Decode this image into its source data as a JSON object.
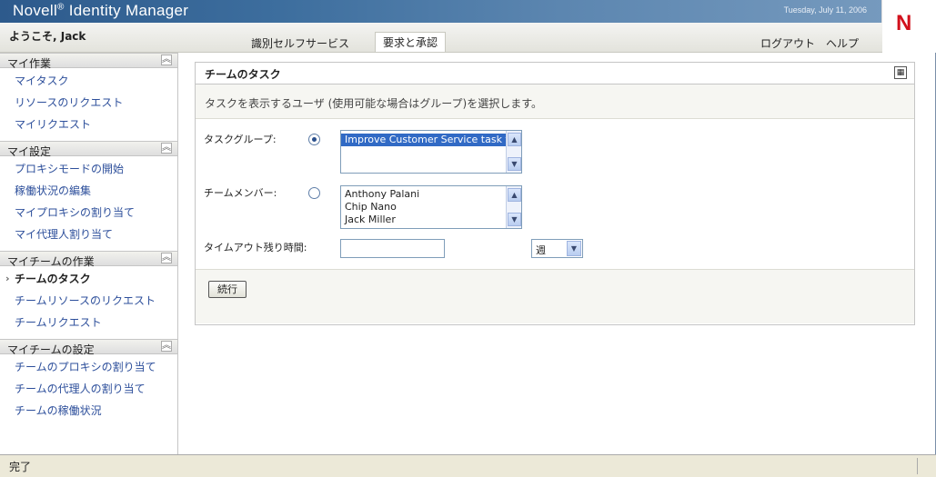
{
  "app": {
    "brand": "Novell",
    "product": "Identity Manager",
    "date": "Tuesday, July 11, 2006",
    "logo_letter": "N",
    "welcome": "ようこそ, Jack"
  },
  "nav": {
    "tabs": [
      {
        "label": "識別セルフサービス"
      },
      {
        "label": "要求と承認"
      }
    ],
    "right": [
      {
        "label": "ログアウト"
      },
      {
        "label": "ヘルプ"
      }
    ]
  },
  "sidebar": {
    "sections": [
      {
        "title": "マイ作業",
        "items": [
          "マイタスク",
          "リソースのリクエスト",
          "マイリクエスト"
        ]
      },
      {
        "title": "マイ設定",
        "items": [
          "プロキシモードの開始",
          "稼働状況の編集",
          "マイプロキシの割り当て",
          "マイ代理人割り当て"
        ]
      },
      {
        "title": "マイチームの作業",
        "items": [
          "チームのタスク",
          "チームリソースのリクエスト",
          "チームリクエスト"
        ]
      },
      {
        "title": "マイチームの設定",
        "items": [
          "チームのプロキシの割り当て",
          "チームの代理人の割り当て",
          "チームの稼働状況"
        ]
      }
    ],
    "current": "チームのタスク"
  },
  "panel": {
    "title": "チームのタスク",
    "instruction": "タスクを表示するユーザ (使用可能な場合はグループ)を選択します。",
    "task_group_label": "タスクグループ:",
    "task_group_options": [
      "Improve Customer Service task fo"
    ],
    "team_member_label": "チームメンバー:",
    "team_members": [
      "Anthony Palani",
      "Chip Nano",
      "Jack Miller"
    ],
    "timeout_label": "タイムアウト残り時間:",
    "timeout_value": "",
    "timeout_unit": "週",
    "continue_label": "続行"
  },
  "status": {
    "text": "完了"
  }
}
